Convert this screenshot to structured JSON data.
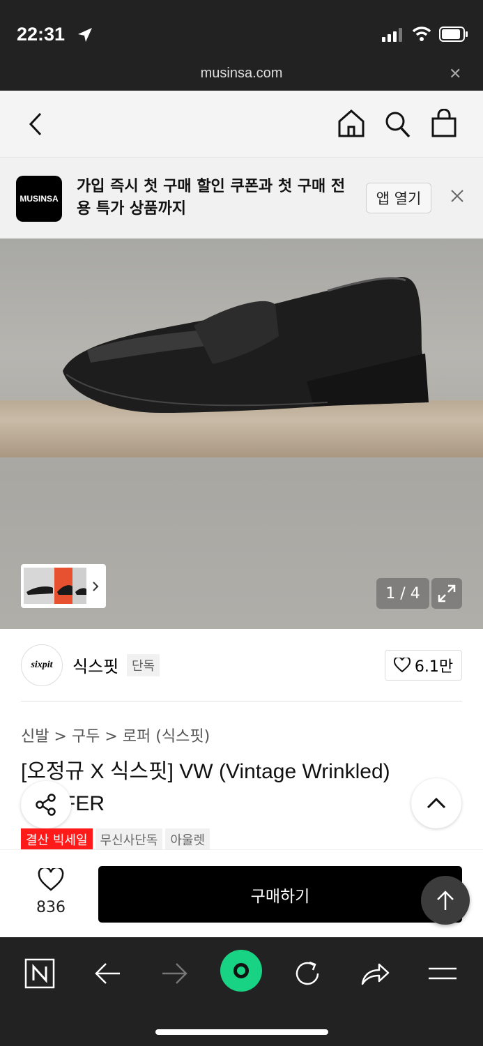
{
  "status": {
    "time": "22:31"
  },
  "browser": {
    "url": "musinsa.com"
  },
  "banner": {
    "logo": "MUSINSA",
    "message": "가입 즉시 첫 구매 할인 쿠폰과 첫 구매 전용 특가 상품까지",
    "open_label": "앱 열기"
  },
  "gallery": {
    "counter": "1 / 4"
  },
  "brand": {
    "logo": "sixpit",
    "name": "식스핏",
    "exclusive_badge": "단독",
    "like_count": "6.1만"
  },
  "breadcrumb": "신발 > 구두 > 로퍼 (식스핏)",
  "product": {
    "title": "[오정규 X 식스핏] VW (Vintage Wrinkled) LOAFER",
    "tags": [
      "결산 빅세일",
      "무신사단독",
      "아울렛"
    ]
  },
  "purchase": {
    "like_count": "836",
    "buy_label": "구매하기"
  },
  "colors": {
    "sale": "#ff1a1a",
    "buy": "#000000",
    "toolbar_accent": "#19d385"
  },
  "icons": [
    "back-icon",
    "home-icon",
    "search-icon",
    "bag-icon",
    "close-icon",
    "expand-icon",
    "heart-icon",
    "share-icon",
    "chevron-up-icon",
    "arrow-up-icon",
    "naver-icon",
    "forward-icon",
    "record-icon",
    "refresh-icon",
    "menu-icon"
  ]
}
